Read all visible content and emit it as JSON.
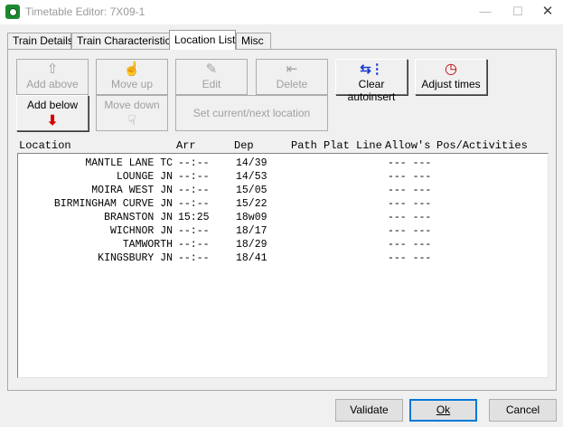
{
  "window": {
    "title": "Timetable Editor: 7X09-1",
    "minimize": "—",
    "maximize": "☐",
    "close": "✕"
  },
  "tabs": [
    {
      "label": "Train Details",
      "active": false
    },
    {
      "label": "Train Characteristics",
      "active": false
    },
    {
      "label": "Location List",
      "active": true
    },
    {
      "label": "Misc",
      "active": false
    }
  ],
  "toolbar": {
    "add_above": "Add above",
    "move_up": "Move up",
    "edit": "Edit",
    "delete": "Delete",
    "clear_autoinsert": "Clear autoinsert",
    "adjust_times": "Adjust times",
    "add_below": "Add below",
    "move_down": "Move down",
    "set_current_next": "Set current/next location"
  },
  "columns": {
    "location": "Location",
    "arr": "Arr",
    "dep": "Dep",
    "path_plat_line": "Path Plat Line",
    "allows": "Allow's",
    "pos_activities": "Pos/Activities"
  },
  "rows": [
    {
      "location": "MANTLE LANE TC",
      "arr": "--:--",
      "dep": "14/39",
      "allow": "--- ---"
    },
    {
      "location": "LOUNGE JN",
      "arr": "--:--",
      "dep": "14/53",
      "allow": "--- ---"
    },
    {
      "location": "MOIRA WEST JN",
      "arr": "--:--",
      "dep": "15/05",
      "allow": "--- ---"
    },
    {
      "location": "BIRMINGHAM CURVE JN",
      "arr": "--:--",
      "dep": "15/22",
      "allow": "--- ---"
    },
    {
      "location": "BRANSTON JN",
      "arr": "15:25",
      "dep": "18w09",
      "allow": "--- ---"
    },
    {
      "location": "WICHNOR JN",
      "arr": "--:--",
      "dep": "18/17",
      "allow": "--- ---"
    },
    {
      "location": "TAMWORTH",
      "arr": "--:--",
      "dep": "18/29",
      "allow": "--- ---"
    },
    {
      "location": "KINGSBURY JN",
      "arr": "--:--",
      "dep": "18/41",
      "allow": "--- ---"
    }
  ],
  "dialog": {
    "validate": "Validate",
    "ok": "Ok",
    "cancel": "Cancel"
  }
}
